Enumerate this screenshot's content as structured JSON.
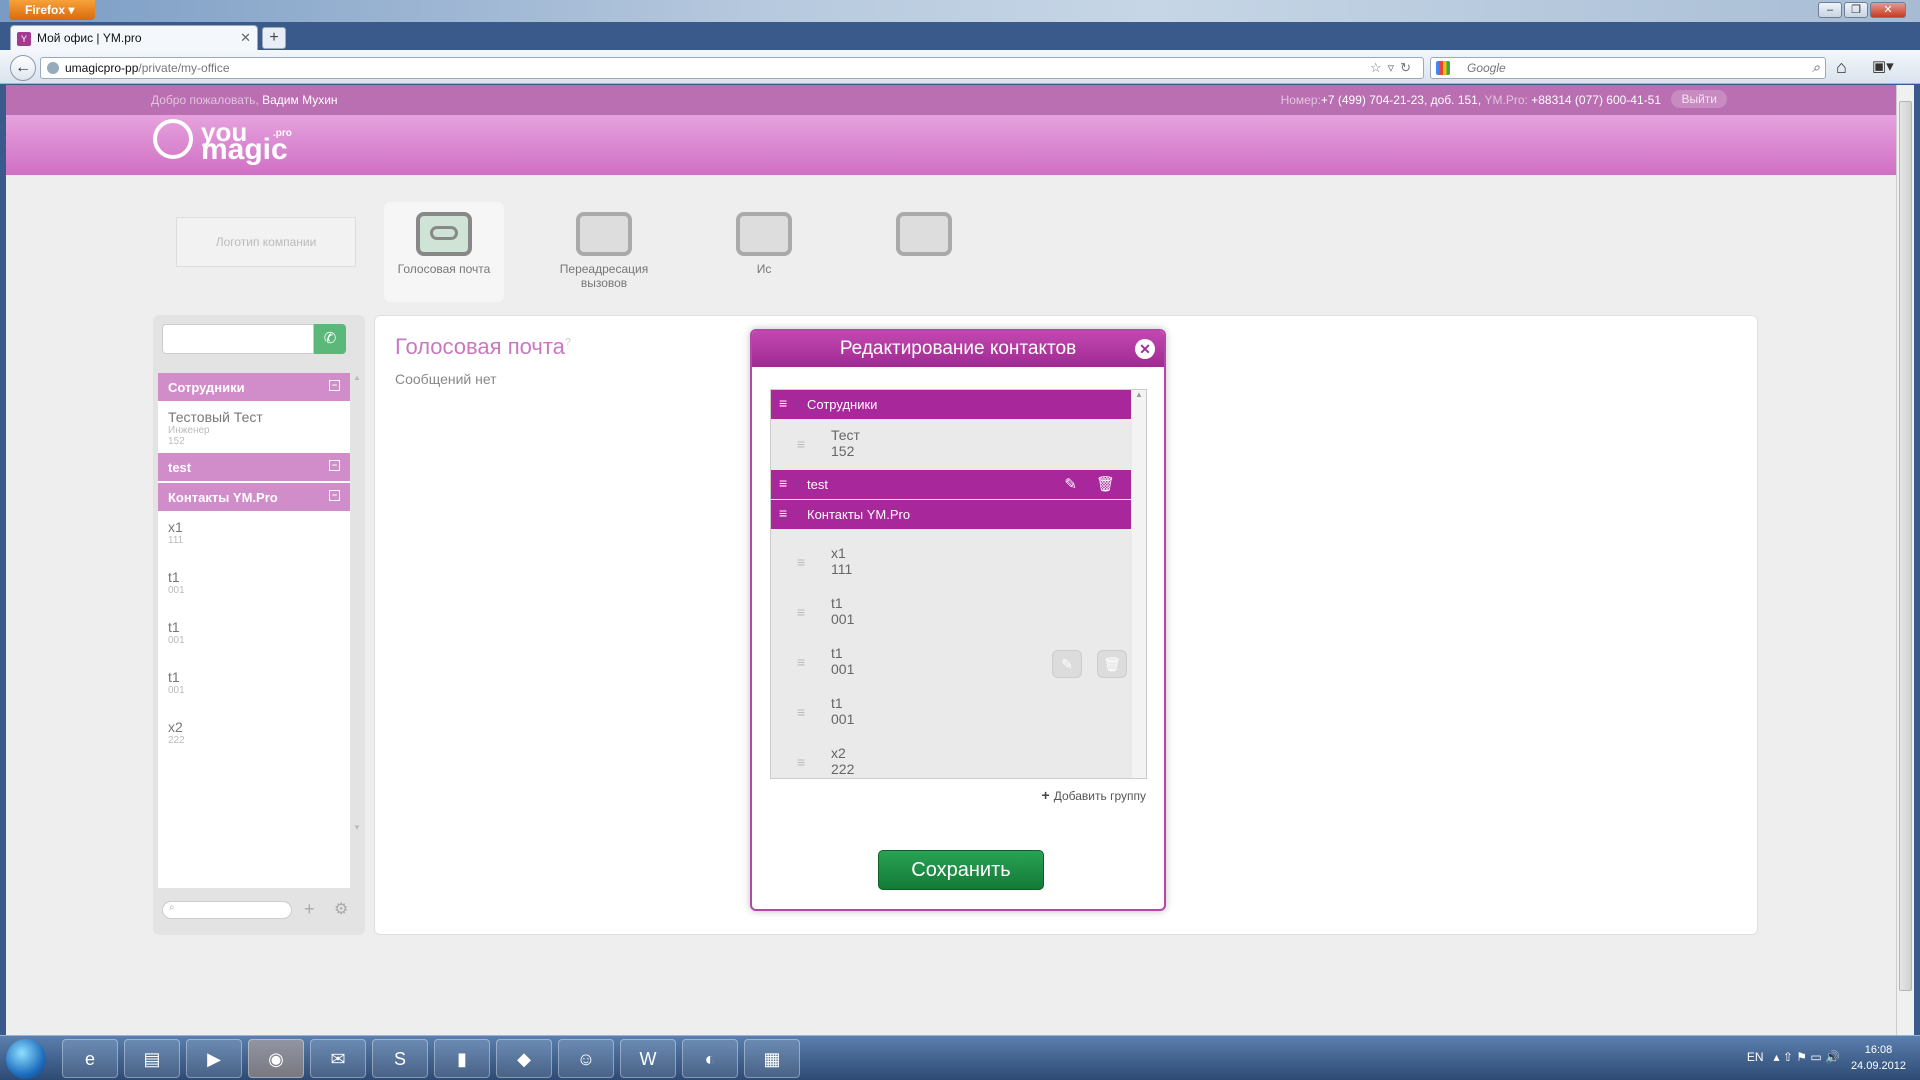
{
  "browser": {
    "menu_label": "Firefox",
    "tab_title": "Мой офис | YM.pro",
    "url_host": "umagicpro-pp",
    "url_path": "/private/my-office",
    "search_placeholder": "Google"
  },
  "topstrip": {
    "welcome_prefix": "Добро пожаловать,",
    "user_name": "Вадим Мухин",
    "phone_label": "Номер:",
    "phone_value": "+7 (499) 704-21-23, доб. 151,",
    "ympro_label": "YM.Pro:",
    "ympro_value": "+88314 (077) 600-41-51",
    "logout_label": "Выйти"
  },
  "logo": {
    "you": "you",
    "magic": "magic",
    "pro": ".pro"
  },
  "tiles": {
    "company_logo": "Логотип компании",
    "items": [
      {
        "label": "Голосовая почта"
      },
      {
        "label": "Переадресация вызовов"
      },
      {
        "label": "Ис"
      },
      {
        "label": ""
      }
    ]
  },
  "sidebar": {
    "groups": [
      {
        "name": "Сотрудники",
        "items": [
          {
            "name": "Тестовый Тест",
            "role": "Инженер",
            "ext": "152"
          }
        ]
      },
      {
        "name": "test",
        "items": []
      },
      {
        "name": "Контакты YM.Pro",
        "items": [
          {
            "name": "x1",
            "ext": "111"
          },
          {
            "name": "t1",
            "ext": "001"
          },
          {
            "name": "t1",
            "ext": "001"
          },
          {
            "name": "t1",
            "ext": "001"
          },
          {
            "name": "x2",
            "ext": "222"
          }
        ]
      }
    ]
  },
  "content": {
    "title": "Голосовая почта",
    "empty_text": "Сообщений нет"
  },
  "modal": {
    "title": "Редактирование контактов",
    "close": "✕",
    "groups": [
      {
        "name": "Сотрудники",
        "items": [
          {
            "name": "Тест",
            "ext": "152"
          }
        ]
      },
      {
        "name": "test",
        "items": []
      },
      {
        "name": "Контакты YM.Pro",
        "items": [
          {
            "name": "x1",
            "ext": "111"
          },
          {
            "name": "t1",
            "ext": "001"
          },
          {
            "name": "t1",
            "ext": "001"
          },
          {
            "name": "t1",
            "ext": "001"
          },
          {
            "name": "x2",
            "ext": "222"
          }
        ]
      }
    ],
    "add_group": "Добавить группу",
    "save": "Сохранить"
  },
  "taskbar": {
    "lang": "EN",
    "time": "16:08",
    "date": "24.09.2012"
  },
  "colors": {
    "brand": "#c348b1",
    "group_dark": "#a8279b",
    "group_light": "#d18dca",
    "save": "#1f8f45"
  }
}
